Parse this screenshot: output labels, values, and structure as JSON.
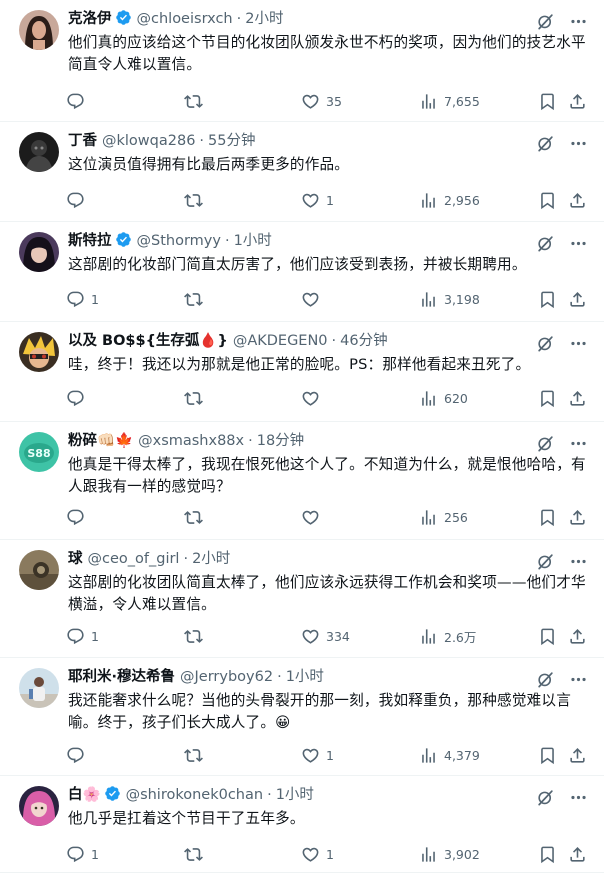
{
  "tweets": [
    {
      "name": "克洛伊",
      "verified": true,
      "handle": "@chloeisrxch",
      "time": "2小时",
      "text": "他们真的应该给这个节目的化妆团队颁发永世不朽的奖项，因为他们的技艺水平简直令人难以置信。",
      "replies": "",
      "retweets": "",
      "likes": "35",
      "views": "7,655",
      "avatar": "woman-dark-hair-avatar"
    },
    {
      "name": "丁香",
      "verified": false,
      "handle": "@klowqa286",
      "time": "55分钟",
      "text": "这位演员值得拥有比最后两季更多的作品。",
      "replies": "",
      "retweets": "",
      "likes": "1",
      "views": "2,956",
      "avatar": "dark-figure-avatar"
    },
    {
      "name": "斯特拉",
      "verified": true,
      "handle": "@Sthormyy",
      "time": "1小时",
      "text": "这部剧的化妆部门简直太厉害了，他们应该受到表扬，并被长期聘用。",
      "replies": "1",
      "retweets": "",
      "likes": "",
      "views": "3,198",
      "avatar": "dark-hair-avatar"
    },
    {
      "name": "以及 BO$${生存弧🩸}",
      "verified": false,
      "handle": "@AKDEGEN0",
      "time": "46分钟",
      "text": "哇，终于！我还以为那就是他正常的脸呢。PS：那样他看起来丑死了。",
      "replies": "",
      "retweets": "",
      "likes": "",
      "views": "620",
      "avatar": "anime-character-avatar"
    },
    {
      "name": "粉碎👊🏻🍁",
      "verified": false,
      "handle": "@xsmashx88x",
      "time": "18分钟",
      "text": "他真是干得太棒了，我现在恨死他这个人了。不知道为什么，就是恨他哈哈，有人跟我有一样的感觉吗？",
      "replies": "",
      "retweets": "",
      "likes": "",
      "views": "256",
      "avatar": "teal-logo-avatar"
    },
    {
      "name": "球",
      "verified": false,
      "handle": "@ceo_of_girl",
      "time": "2小时",
      "text": "这部剧的化妆团队简直太棒了，他们应该永远获得工作机会和奖项——他们才华横溢，令人难以置信。",
      "replies": "1",
      "retweets": "",
      "likes": "334",
      "views": "2.6万",
      "avatar": "photo-avatar"
    },
    {
      "name": "耶利米·穆达希鲁",
      "verified": false,
      "handle": "@Jerryboy62",
      "time": "1小时",
      "text": "我还能奢求什么呢？当他的头骨裂开的那一刻，我如释重负，那种感觉难以言喻。终于，孩子们长大成人了。😀",
      "replies": "",
      "retweets": "",
      "likes": "1",
      "views": "4,379",
      "avatar": "person-outdoor-avatar"
    },
    {
      "name": "白🌸",
      "verified": true,
      "handle": "@shirokonek0chan",
      "time": "1小时",
      "text": "他几乎是扛着这个节目干了五年多。",
      "replies": "1",
      "retweets": "",
      "likes": "1",
      "views": "3,902",
      "avatar": "pink-hair-avatar"
    }
  ],
  "icons": {
    "grok": "grok-icon",
    "more": "more-icon",
    "reply": "reply-icon",
    "retweet": "retweet-icon",
    "like": "heart-icon",
    "views": "views-chart-icon",
    "bookmark": "bookmark-icon",
    "share": "share-icon",
    "verified": "verified-badge-icon"
  },
  "colors": {
    "text": "#0f1419",
    "muted": "#536471",
    "verified": "#1d9bf0",
    "divider": "#eff3f4"
  }
}
